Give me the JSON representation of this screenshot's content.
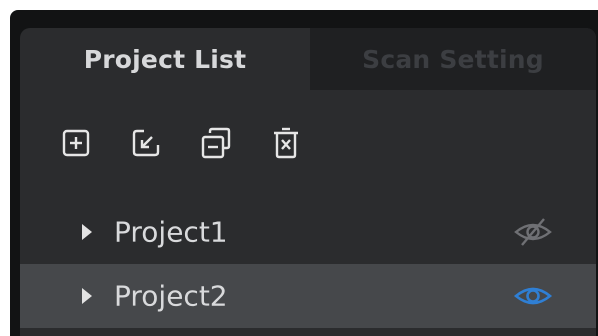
{
  "tabs": [
    {
      "label": "Project List",
      "active": true
    },
    {
      "label": "Scan Setting",
      "active": false
    }
  ],
  "toolbar": {
    "buttons": [
      {
        "icon": "add-icon"
      },
      {
        "icon": "import-icon"
      },
      {
        "icon": "merge-icon"
      },
      {
        "icon": "delete-icon"
      }
    ]
  },
  "projects": [
    {
      "label": "Project1",
      "visible": false,
      "selected": false
    },
    {
      "label": "Project2",
      "visible": true,
      "selected": true
    }
  ],
  "colors": {
    "panel_bg": "#2b2c2e",
    "selected_row": "#46484b",
    "icon": "#e6e6e6",
    "visible_eye": "#2f7fd4",
    "hidden_eye": "#6f7074"
  }
}
